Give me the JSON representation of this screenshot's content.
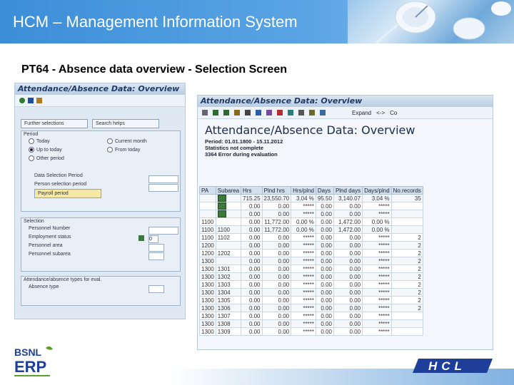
{
  "header": {
    "title": "HCM – Management Information System"
  },
  "slide": {
    "subtitle": "PT64 - Absence data overview  - Selection Screen"
  },
  "selection_screen": {
    "title": "Attendance/Absence Data: Overview",
    "buttons": {
      "further_selections": "Further selections",
      "search_helps": "Search helps"
    },
    "period_group": {
      "title": "Period",
      "options": [
        "Today",
        "Current month",
        "Up to today",
        "From today",
        "Other period"
      ],
      "selected": "Up to today",
      "data_selection_period": "Data Selection Period",
      "person_selection_period": "Person selection period",
      "payroll_period": "Payroll period"
    },
    "selection_group": {
      "title": "Selection",
      "fields": [
        "Personnel Number",
        "Employment status",
        "Personnel area",
        "Personnel subarea"
      ],
      "employment_status_value": "0"
    },
    "types_group": {
      "title": "Attendance/absence types for eval.",
      "field": "Absence type"
    }
  },
  "report": {
    "window_title": "Attendance/Absence Data: Overview",
    "toolbar_expand": "Expand",
    "toolbar_collapse": "<->",
    "toolbar_end": "Co",
    "title": "Attendance/Absence Data: Overview",
    "period_line": "Period: 01.01.1800 - 15.11.2012",
    "status_line": "Statistics not complete",
    "error_line": "3364 Error during evaluation",
    "columns": [
      "PA",
      "Subarea",
      "Hrs",
      "Plnd hrs",
      "Hrs/plnd",
      "Days",
      "Plnd days",
      "Days/plnd",
      "No.records"
    ],
    "rows": [
      [
        "",
        "",
        "715.25",
        "23,550.70",
        "3.04 %",
        "95.50",
        "3,140.07",
        "3.04 %",
        "35"
      ],
      [
        "",
        "",
        "0.00",
        "0.00",
        "*****",
        "0.00",
        "0.00",
        "*****",
        ""
      ],
      [
        "",
        "",
        "0.00",
        "0.00",
        "*****",
        "0.00",
        "0.00",
        "*****",
        ""
      ],
      [
        "1100",
        "",
        "0.00",
        "11,772.00",
        "0.00 %",
        "0.00",
        "1,472.00",
        "0.00 %",
        ""
      ],
      [
        "1100",
        "1100",
        "0.00",
        "11,772.00",
        "0.00 %",
        "0.00",
        "1,472.00",
        "0.00 %",
        ""
      ],
      [
        "1100",
        "1102",
        "0.00",
        "0.00",
        "*****",
        "0.00",
        "0.00",
        "*****",
        "2"
      ],
      [
        "1200",
        "",
        "0.00",
        "0.00",
        "*****",
        "0.00",
        "0.00",
        "*****",
        "2"
      ],
      [
        "1200",
        "1202",
        "0.00",
        "0.00",
        "*****",
        "0.00",
        "0.00",
        "*****",
        "2"
      ],
      [
        "1300",
        "",
        "0.00",
        "0.00",
        "*****",
        "0.00",
        "0.00",
        "*****",
        "2"
      ],
      [
        "1300",
        "1301",
        "0.00",
        "0.00",
        "*****",
        "0.00",
        "0.00",
        "*****",
        "2"
      ],
      [
        "1300",
        "1302",
        "0.00",
        "0.00",
        "*****",
        "0.00",
        "0.00",
        "*****",
        "2"
      ],
      [
        "1300",
        "1303",
        "0.00",
        "0.00",
        "*****",
        "0.00",
        "0.00",
        "*****",
        "2"
      ],
      [
        "1300",
        "1304",
        "0.00",
        "0.00",
        "*****",
        "0.00",
        "0.00",
        "*****",
        "2"
      ],
      [
        "1300",
        "1305",
        "0.00",
        "0.00",
        "*****",
        "0.00",
        "0.00",
        "*****",
        "2"
      ],
      [
        "1300",
        "1306",
        "0.00",
        "0.00",
        "*****",
        "0.00",
        "0.00",
        "*****",
        "2"
      ],
      [
        "1300",
        "1307",
        "0.00",
        "0.00",
        "*****",
        "0.00",
        "0.00",
        "*****",
        ""
      ],
      [
        "1300",
        "1308",
        "0.00",
        "0.00",
        "*****",
        "0.00",
        "0.00",
        "*****",
        ""
      ],
      [
        "1300",
        "1309",
        "0.00",
        "0.00",
        "*****",
        "0.00",
        "0.00",
        "*****",
        ""
      ]
    ],
    "icon_rows": [
      0,
      1,
      2,
      4,
      7
    ]
  },
  "logos": {
    "bsnl": "BSNL",
    "erp": "ERP",
    "hcl": "HCL"
  },
  "colors": {
    "header": "#3c8ed8",
    "sap_title": "#223b66",
    "hcl_blue": "#1d3f99"
  }
}
